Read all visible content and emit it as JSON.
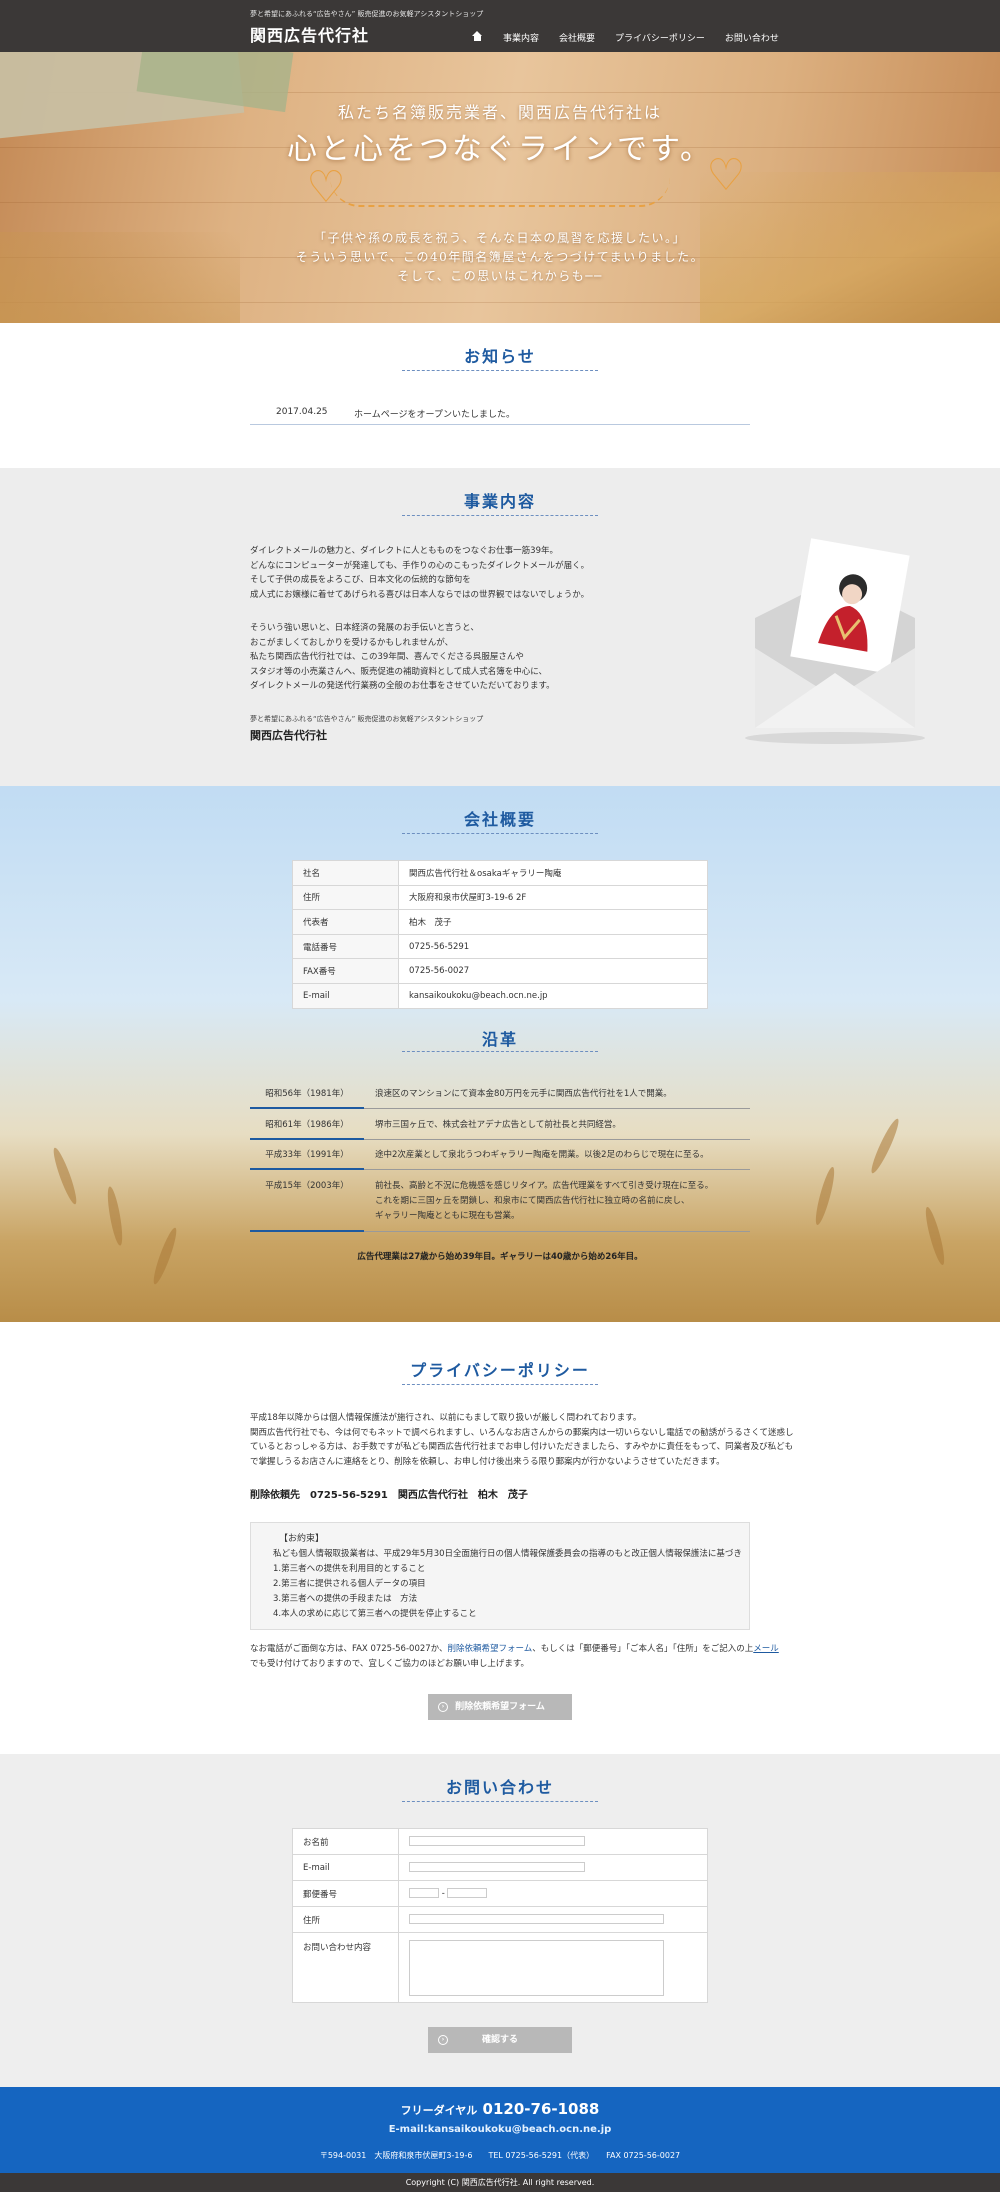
{
  "header": {
    "tagline": "夢と希望にあふれる“広告やさん” 販売促進のお気軽アシスタントショップ",
    "logo": "関西広告代行社",
    "nav": [
      "事業内容",
      "会社概要",
      "プライバシーポリシー",
      "お問い合わせ"
    ]
  },
  "hero": {
    "line1": "私たち名簿販売業者、関西広告代行社は",
    "line2": "心と心をつなぐラインです。",
    "p1": "「子供や孫の成長を祝う、そんな日本の風習を応援したい。」",
    "p2": "そういう思いで、この40年間名簿屋さんをつづけてまいりました。",
    "p3": "そして、この思いはこれからも──"
  },
  "news": {
    "title": "お知らせ",
    "items": [
      {
        "date": "2017.04.25",
        "text": "ホームページをオープンいたしました。"
      }
    ]
  },
  "business": {
    "title": "事業内容",
    "para1": [
      "ダイレクトメールの魅力と、ダイレクトに人ともものをつなぐお仕事一筋39年。",
      "どんなにコンピューターが発達しても、手作りの心のこもったダイレクトメールが届く。",
      "そして子供の成長をよろこび、日本文化の伝統的な節句を",
      "成人式にお嬢様に着せてあげられる喜びは日本人ならではの世界観ではないでしょうか。"
    ],
    "para2": [
      "そういう強い思いと、日本経済の発展のお手伝いと言うと、",
      "おこがましくておしかりを受けるかもしれませんが、",
      "私たち関西広告代行社では、この39年間、喜んでくださる呉服屋さんや",
      "スタジオ等の小売業さんへ、販売促進の補助資料として成人式名簿を中心に、",
      "ダイレクトメールの発送代行業務の全般のお仕事をさせていただいております。"
    ],
    "sub": "夢と希望にあふれる“広告やさん” 販売促進のお気軽アシスタントショップ",
    "name": "関西広告代行社"
  },
  "company": {
    "title": "会社概要",
    "rows": [
      {
        "k": "社名",
        "v": "関西広告代行社＆osakaギャラリー陶庵"
      },
      {
        "k": "住所",
        "v": "大阪府和泉市伏屋町3-19-6 2F"
      },
      {
        "k": "代表者",
        "v": "柏木　茂子"
      },
      {
        "k": "電話番号",
        "v": "0725-56-5291"
      },
      {
        "k": "FAX番号",
        "v": "0725-56-0027"
      },
      {
        "k": "E-mail",
        "v": "kansaikoukoku@beach.ocn.ne.jp"
      }
    ]
  },
  "history": {
    "title": "沿革",
    "items": [
      {
        "year": "昭和56年（1981年）",
        "lines": [
          "浪速区のマンションにて資本金80万円を元手に関西広告代行社を1人で開業。"
        ]
      },
      {
        "year": "昭和61年（1986年）",
        "lines": [
          "堺市三国ヶ丘で、株式会社アデナ広告として前社長と共同経営。"
        ]
      },
      {
        "year": "平成33年（1991年）",
        "lines": [
          "途中2次産業として泉北うつわギャラリー陶庵を開業。以後2足のわらじで現在に至る。"
        ]
      },
      {
        "year": "平成15年（2003年）",
        "lines": [
          "前社長、高齢と不況に危機感を感じリタイア。広告代理業をすべて引き受け現在に至る。",
          "これを期に三国ヶ丘を閉鎖し、和泉市にて関西広告代行社に独立時の名前に戻し、",
          "ギャラリー陶庵とともに現在も営業。"
        ]
      }
    ],
    "note": "広告代理業は27歳から始め39年目。ギャラリーは40歳から始め26年目。"
  },
  "privacy": {
    "title": "プライバシーポリシー",
    "p1": "平成18年以降からは個人情報保護法が施行され、以前にもまして取り扱いが厳しく問われております。",
    "p2": "関西広告代行社でも、今は何でもネットで調べられますし、いろんなお店さんからの郵案内は一切いらないし電話での勧誘がうるさくて迷惑し",
    "p3": "ているとおっしゃる方は、お手数ですが私ども関西広告代行社までお申し付けいただきましたら、すみやかに責任をもって、同業者及び私ども",
    "p4": "で掌握しうるお店さんに連絡をとり、削除を依頼し、お申し付け後出来うる限り郵案内が行かないようさせていただきます。",
    "contact": "削除依頼先　0725-56-5291　関西広告代行社　柏木　茂子",
    "promise_title": "【お約束】",
    "promise": [
      "私ども個人情報取扱業者は、平成29年5月30日全面施行日の個人情報保護委員会の指導のもと改正個人情報保護法に基づき",
      "1.第三者への提供を利用目的とすること",
      "2.第三者に提供される個人データの項目",
      "3.第三者への提供の手段または　方法",
      "4.本人の求めに応じて第三者への提供を停止すること"
    ],
    "after1_a": "なお電話がご面倒な方は、FAX 0725-56-0027か、",
    "after1_link": "削除依頼希望フォーム",
    "after1_b": "、もしくは「郵便番号」「ご本人名」「住所」をご記入の上",
    "after1_mail": "メール",
    "after2": "でも受け付けておりますので、宜しくご協力のほどお願い申し上げます。",
    "button": "削除依頼希望フォーム"
  },
  "inquiry": {
    "title": "お問い合わせ",
    "fields": [
      "お名前",
      "E-mail",
      "郵便番号",
      "住所",
      "お問い合わせ内容"
    ],
    "zip_sep": "-",
    "button": "確認する"
  },
  "footer": {
    "freedial_label": "フリーダイヤル",
    "freedial": "0120-76-1088",
    "email": "E-mail:kansaikoukoku@beach.ocn.ne.jp",
    "address": "〒594-0031　大阪府和泉市伏屋町3-19-6　　TEL 0725-56-5291（代表）　　FAX 0725-56-0027",
    "copyright": "Copyright (C) 関西広告代行社. All right reserved."
  },
  "colors": {
    "accent": "#1e5aa0",
    "footer": "#1565c0",
    "header": "#3b3837",
    "heart": "#e8a143"
  }
}
